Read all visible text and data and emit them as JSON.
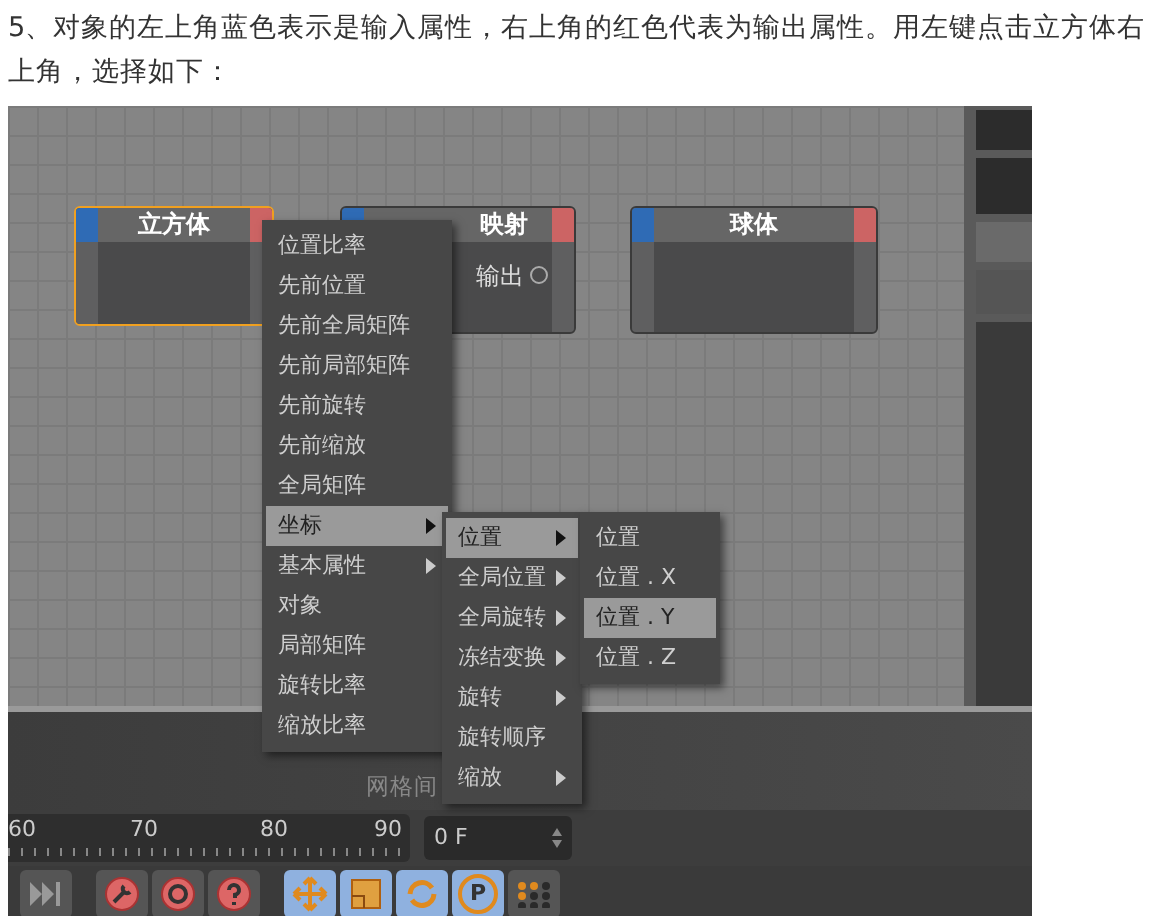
{
  "article": {
    "paragraph": "5、对象的左上角蓝色表示是输入属性，右上角的红色代表为输出属性。用左键点击立方体右上角，选择如下："
  },
  "editor": {
    "nodes": [
      {
        "title": "立方体",
        "selected": true
      },
      {
        "title": "映射",
        "selected": false,
        "port": "输出"
      },
      {
        "title": "球体",
        "selected": false
      }
    ],
    "menus": [
      {
        "items": [
          {
            "label": "位置比率",
            "selected": false,
            "submenu": false
          },
          {
            "label": "先前位置",
            "selected": false,
            "submenu": false
          },
          {
            "label": "先前全局矩阵",
            "selected": false,
            "submenu": false
          },
          {
            "label": "先前局部矩阵",
            "selected": false,
            "submenu": false
          },
          {
            "label": "先前旋转",
            "selected": false,
            "submenu": false
          },
          {
            "label": "先前缩放",
            "selected": false,
            "submenu": false
          },
          {
            "label": "全局矩阵",
            "selected": false,
            "submenu": false
          },
          {
            "label": "坐标",
            "selected": true,
            "submenu": true
          },
          {
            "label": "基本属性",
            "selected": false,
            "submenu": true
          },
          {
            "label": "对象",
            "selected": false,
            "submenu": false
          },
          {
            "label": "局部矩阵",
            "selected": false,
            "submenu": false
          },
          {
            "label": "旋转比率",
            "selected": false,
            "submenu": false
          },
          {
            "label": "缩放比率",
            "selected": false,
            "submenu": false
          }
        ]
      },
      {
        "items": [
          {
            "label": "位置",
            "selected": true,
            "submenu": true
          },
          {
            "label": "全局位置",
            "selected": false,
            "submenu": true
          },
          {
            "label": "全局旋转",
            "selected": false,
            "submenu": true
          },
          {
            "label": "冻结变换",
            "selected": false,
            "submenu": true
          },
          {
            "label": "旋转",
            "selected": false,
            "submenu": true
          },
          {
            "label": "旋转顺序",
            "selected": false,
            "submenu": false
          },
          {
            "label": "缩放",
            "selected": false,
            "submenu": true
          }
        ]
      },
      {
        "items": [
          {
            "label": "位置",
            "selected": false,
            "submenu": false
          },
          {
            "label": "位置 . X",
            "selected": false,
            "submenu": false
          },
          {
            "label": "位置 . Y",
            "selected": true,
            "submenu": false
          },
          {
            "label": "位置 . Z",
            "selected": false,
            "submenu": false
          }
        ]
      }
    ],
    "grid_label": "网格间",
    "timeline": {
      "ticks": [
        "60",
        "70",
        "80",
        "90"
      ],
      "frame": "0 F"
    },
    "toolbar": [
      {
        "kind": "skip-end",
        "active": false
      },
      {
        "kind": "wrench",
        "active": false
      },
      {
        "kind": "refresh",
        "active": false
      },
      {
        "kind": "help",
        "active": false
      },
      {
        "kind": "move",
        "active": true
      },
      {
        "kind": "scale",
        "active": true
      },
      {
        "kind": "rotate",
        "active": true
      },
      {
        "kind": "pivot",
        "active": true,
        "label": "P"
      },
      {
        "kind": "dots",
        "active": false
      }
    ]
  }
}
